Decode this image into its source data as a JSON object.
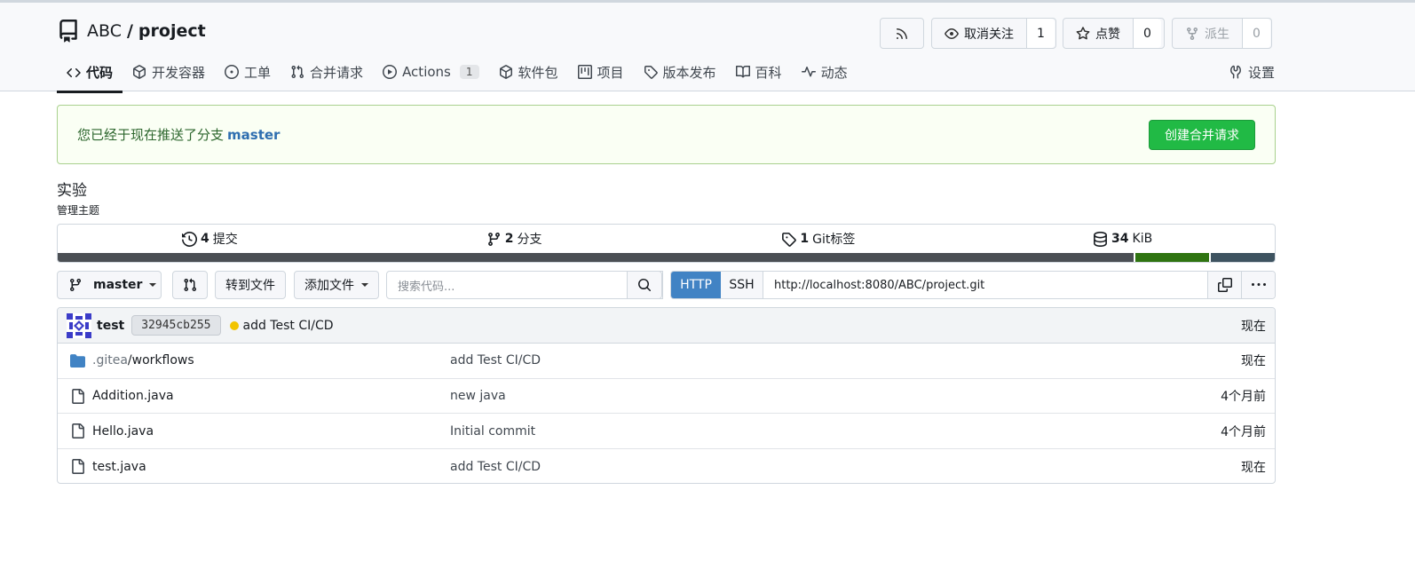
{
  "repo": {
    "owner": "ABC",
    "separator": "/",
    "name": "project"
  },
  "header_buttons": {
    "watch": {
      "label": "取消关注",
      "count": "1"
    },
    "star": {
      "label": "点赞",
      "count": "0"
    },
    "fork": {
      "label": "派生",
      "count": "0"
    }
  },
  "tabs": [
    {
      "label": "代码",
      "icon": "code-icon"
    },
    {
      "label": "开发容器",
      "icon": "package-icon"
    },
    {
      "label": "工单",
      "icon": "issue-icon"
    },
    {
      "label": "合并请求",
      "icon": "pull-request-icon"
    },
    {
      "label": "Actions",
      "icon": "play-icon",
      "badge": "1"
    },
    {
      "label": "软件包",
      "icon": "package-icon"
    },
    {
      "label": "项目",
      "icon": "project-icon"
    },
    {
      "label": "版本发布",
      "icon": "tag-icon"
    },
    {
      "label": "百科",
      "icon": "book-icon"
    },
    {
      "label": "动态",
      "icon": "pulse-icon"
    }
  ],
  "settings_label": "设置",
  "notice": {
    "message": "您已经于现在推送了分支",
    "branch": "master",
    "button": "创建合并请求"
  },
  "description": "实验",
  "manage_topics": "管理主题",
  "stats": {
    "commits": {
      "count": "4",
      "label": "提交"
    },
    "branches": {
      "count": "2",
      "label": "分支"
    },
    "tags": {
      "count": "1",
      "label": "Git标签"
    },
    "size": {
      "count": "34",
      "label": "KiB"
    }
  },
  "language_bar": [
    {
      "color": "#4b4f54",
      "percent": 88.4
    },
    {
      "color": "#2f7411",
      "percent": 6.2
    },
    {
      "color": "#3e5360",
      "percent": 5.4
    }
  ],
  "toolbar": {
    "branch": "master",
    "goto_file": "转到文件",
    "add_file": "添加文件",
    "search_placeholder": "搜索代码...",
    "http": "HTTP",
    "ssh": "SSH",
    "clone_url": "http://localhost:8080/ABC/project.git"
  },
  "latest_commit": {
    "author": "test",
    "sha": "32945cb255",
    "message": "add Test CI/CD",
    "time": "现在"
  },
  "files": [
    {
      "prefix": ".gitea",
      "name": "/workflows",
      "type": "folder",
      "message": "add Test CI/CD",
      "time": "现在"
    },
    {
      "prefix": "",
      "name": "Addition.java",
      "type": "file",
      "message": "new java",
      "time": "4个月前"
    },
    {
      "prefix": "",
      "name": "Hello.java",
      "type": "file",
      "message": "Initial commit",
      "time": "4个月前"
    },
    {
      "prefix": "",
      "name": "test.java",
      "type": "file",
      "message": "add Test CI/CD",
      "time": "现在"
    }
  ]
}
